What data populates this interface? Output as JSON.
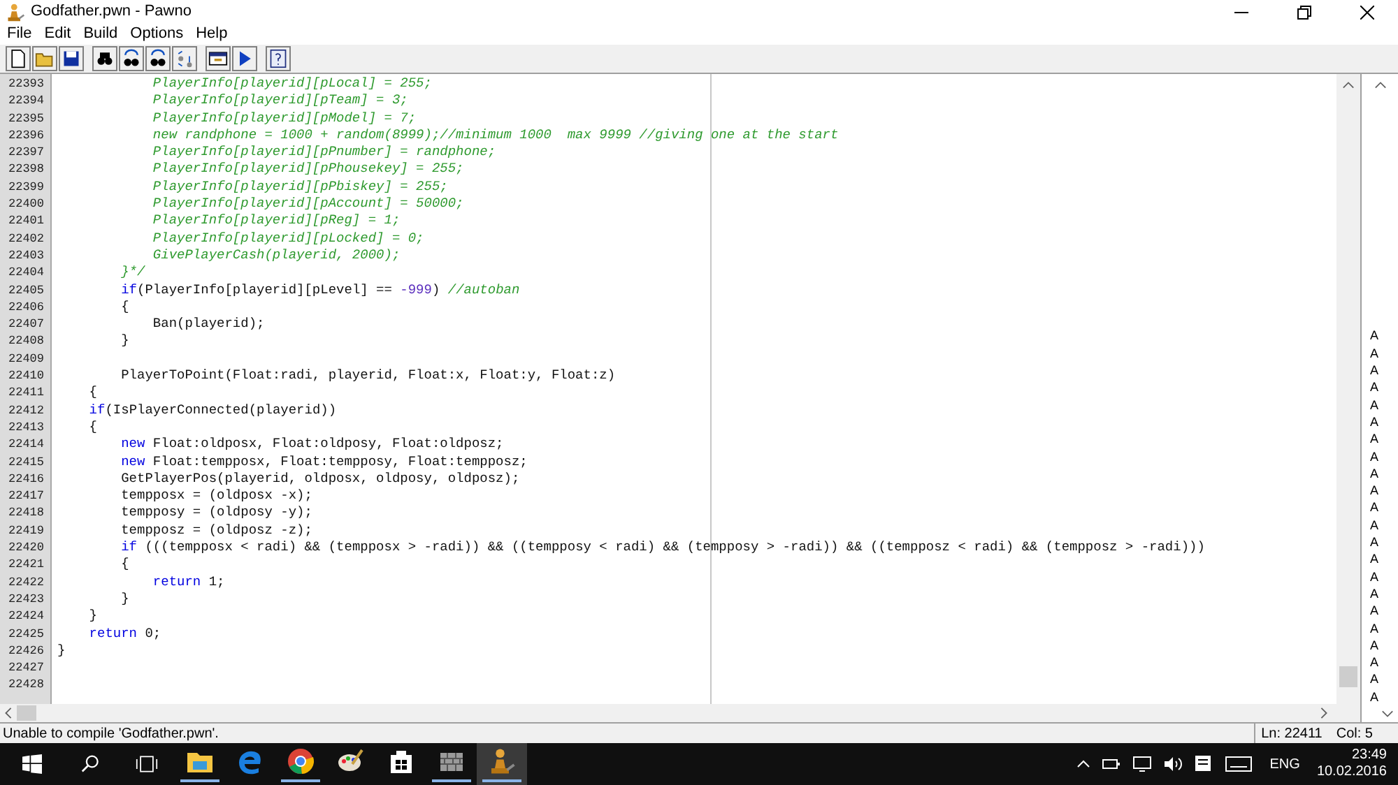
{
  "window": {
    "title": "Godfather.pwn - Pawno"
  },
  "menu": [
    "File",
    "Edit",
    "Build",
    "Options",
    "Help"
  ],
  "editor": {
    "lines": [
      {
        "number": "22393",
        "segments": [
          {
            "kind": "comment",
            "text": "            PlayerInfo[playerid][pLocal] = 255;"
          }
        ]
      },
      {
        "number": "22394",
        "segments": [
          {
            "kind": "comment",
            "text": "            PlayerInfo[playerid][pTeam] = 3;"
          }
        ]
      },
      {
        "number": "22395",
        "segments": [
          {
            "kind": "comment",
            "text": "            PlayerInfo[playerid][pModel] = 7;"
          }
        ]
      },
      {
        "number": "22396",
        "segments": [
          {
            "kind": "comment",
            "text": "            new randphone = 1000 + random(8999);//minimum 1000  max 9999 //giving one at the start"
          }
        ]
      },
      {
        "number": "22397",
        "segments": [
          {
            "kind": "comment",
            "text": "            PlayerInfo[playerid][pPnumber] = randphone;"
          }
        ]
      },
      {
        "number": "22398",
        "segments": [
          {
            "kind": "comment",
            "text": "            PlayerInfo[playerid][pPhousekey] = 255;"
          }
        ]
      },
      {
        "number": "22399",
        "segments": [
          {
            "kind": "comment",
            "text": "            PlayerInfo[playerid][pPbiskey] = 255;"
          }
        ]
      },
      {
        "number": "22400",
        "segments": [
          {
            "kind": "comment",
            "text": "            PlayerInfo[playerid][pAccount] = 50000;"
          }
        ]
      },
      {
        "number": "22401",
        "segments": [
          {
            "kind": "comment",
            "text": "            PlayerInfo[playerid][pReg] = 1;"
          }
        ]
      },
      {
        "number": "22402",
        "segments": [
          {
            "kind": "comment",
            "text": "            PlayerInfo[playerid][pLocked] = 0;"
          }
        ]
      },
      {
        "number": "22403",
        "segments": [
          {
            "kind": "comment",
            "text": "            GivePlayerCash(playerid, 2000);"
          }
        ]
      },
      {
        "number": "22404",
        "segments": [
          {
            "kind": "comment",
            "text": "        }*/"
          }
        ]
      },
      {
        "number": "22405",
        "segments": [
          {
            "kind": "keyword",
            "text": "        if"
          },
          {
            "kind": "plain",
            "text": "(PlayerInfo[playerid][pLevel] == "
          },
          {
            "kind": "number",
            "text": "-999"
          },
          {
            "kind": "plain",
            "text": ") "
          },
          {
            "kind": "comment",
            "text": "//autoban"
          }
        ]
      },
      {
        "number": "22406",
        "segments": [
          {
            "kind": "plain",
            "text": "        {"
          }
        ]
      },
      {
        "number": "22407",
        "segments": [
          {
            "kind": "plain",
            "text": "            Ban(playerid);"
          }
        ]
      },
      {
        "number": "22408",
        "segments": [
          {
            "kind": "plain",
            "text": "        }"
          }
        ]
      },
      {
        "number": "22409"
      },
      {
        "number": "22410",
        "segments": [
          {
            "kind": "plain",
            "text": "        PlayerToPoint(Float:radi, playerid, Float:x, Float:y, Float:z)"
          }
        ]
      },
      {
        "number": "22411",
        "segments": [
          {
            "kind": "plain",
            "text": "    {"
          }
        ]
      },
      {
        "number": "22412",
        "segments": [
          {
            "kind": "keyword",
            "text": "    if"
          },
          {
            "kind": "plain",
            "text": "(IsPlayerConnected(playerid))"
          }
        ]
      },
      {
        "number": "22413",
        "segments": [
          {
            "kind": "plain",
            "text": "    {"
          }
        ]
      },
      {
        "number": "22414",
        "segments": [
          {
            "kind": "keyword",
            "text": "        new"
          },
          {
            "kind": "plain",
            "text": " Float:oldposx, Float:oldposy, Float:oldposz;"
          }
        ]
      },
      {
        "number": "22415",
        "segments": [
          {
            "kind": "keyword",
            "text": "        new"
          },
          {
            "kind": "plain",
            "text": " Float:tempposx, Float:tempposy, Float:tempposz;"
          }
        ]
      },
      {
        "number": "22416",
        "segments": [
          {
            "kind": "plain",
            "text": "        GetPlayerPos(playerid, oldposx, oldposy, oldposz);"
          }
        ]
      },
      {
        "number": "22417",
        "segments": [
          {
            "kind": "plain",
            "text": "        tempposx = (oldposx -x);"
          }
        ]
      },
      {
        "number": "22418",
        "segments": [
          {
            "kind": "plain",
            "text": "        tempposy = (oldposy -y);"
          }
        ]
      },
      {
        "number": "22419",
        "segments": [
          {
            "kind": "plain",
            "text": "        tempposz = (oldposz -z);"
          }
        ]
      },
      {
        "number": "22420",
        "segments": [
          {
            "kind": "keyword",
            "text": "        if"
          },
          {
            "kind": "plain",
            "text": " (((tempposx < radi) && (tempposx > -radi)) && ((tempposy < radi) && (tempposy > -radi)) && ((tempposz < radi) && (tempposz > -radi)))"
          }
        ]
      },
      {
        "number": "22421",
        "segments": [
          {
            "kind": "plain",
            "text": "        {"
          }
        ]
      },
      {
        "number": "22422",
        "segments": [
          {
            "kind": "keyword",
            "text": "            return"
          },
          {
            "kind": "plain",
            "text": " 1;"
          }
        ]
      },
      {
        "number": "22423",
        "segments": [
          {
            "kind": "plain",
            "text": "        }"
          }
        ]
      },
      {
        "number": "22424",
        "segments": [
          {
            "kind": "plain",
            "text": "    }"
          }
        ]
      },
      {
        "number": "22425",
        "segments": [
          {
            "kind": "keyword",
            "text": "    return"
          },
          {
            "kind": "plain",
            "text": " 0;"
          }
        ]
      },
      {
        "number": "22426",
        "segments": [
          {
            "kind": "plain",
            "text": "}"
          }
        ]
      },
      {
        "number": "22427"
      },
      {
        "number": "22428"
      }
    ]
  },
  "side_pane": {
    "letters": [
      "A",
      "A",
      "A",
      "A",
      "A",
      "A",
      "A",
      "A",
      "A",
      "A",
      "A",
      "A",
      "A",
      "A",
      "A",
      "A",
      "A",
      "A",
      "A",
      "A",
      "A",
      "A"
    ]
  },
  "status_bar": {
    "message": "Unable to compile 'Godfather.pwn'.",
    "line": "Ln: 22411",
    "column": "Col: 5"
  },
  "taskbar": {
    "apps": [
      {
        "kind": "explorer",
        "running": true,
        "selected": false
      },
      {
        "kind": "edge",
        "running": false,
        "selected": false
      },
      {
        "kind": "chrome",
        "running": true,
        "selected": false
      },
      {
        "kind": "paint",
        "running": false,
        "selected": false
      },
      {
        "kind": "store",
        "running": false,
        "selected": false
      },
      {
        "kind": "wall",
        "running": true,
        "selected": false
      },
      {
        "kind": "pawn",
        "running": true,
        "selected": true
      }
    ],
    "language": "ENG",
    "time": "23:49",
    "date": "10.02.2016"
  }
}
